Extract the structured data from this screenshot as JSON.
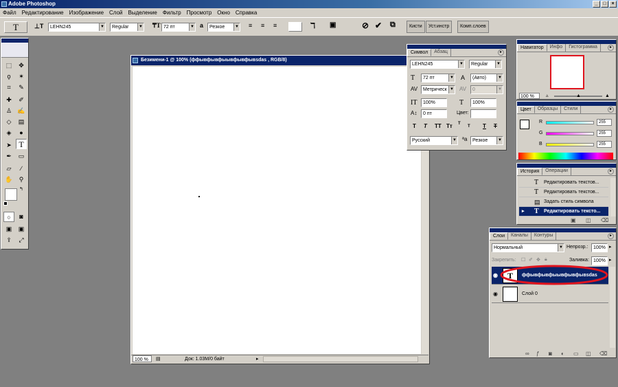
{
  "app": {
    "title": "Adobe Photoshop"
  },
  "menu": [
    "Файл",
    "Редактирование",
    "Изображение",
    "Слой",
    "Выделение",
    "Фильтр",
    "Просмотр",
    "Окно",
    "Справка"
  ],
  "options": {
    "font_family": "LEHN245",
    "font_style": "Regular",
    "font_size": "72 пт",
    "antialias": "Резкое",
    "aa_icon": "a",
    "palette_tabs": [
      "Кисти",
      "Уст.инстр",
      "Комп.слоев"
    ]
  },
  "document": {
    "title": "Безимени-1 @ 100% (ффывфывфыывфывфывsdas , RGB/8)",
    "zoom": "100 %",
    "doc_size": "Док: 1.03M/0 байт"
  },
  "character_panel": {
    "tabs": [
      "Символ",
      "Абзац"
    ],
    "font_family": "LEHN245",
    "font_style": "Regular",
    "size": "72 пт",
    "leading": "(Авто)",
    "kerning": "Метрическ",
    "tracking": "0",
    "vscale": "100%",
    "hscale": "100%",
    "baseline": "0 пт",
    "color_label": "Цвет:",
    "language": "Русский",
    "antialias": "Резкое",
    "style_buttons": [
      "T",
      "T",
      "TT",
      "Tт",
      "T",
      "T",
      "T",
      "T"
    ]
  },
  "navigator_panel": {
    "tabs": [
      "Навигатор",
      "Инфо",
      "Гистограмма"
    ],
    "zoom": "100 %"
  },
  "color_panel": {
    "tabs": [
      "Цвет",
      "Образцы",
      "Стили"
    ],
    "r_label": "R",
    "g_label": "G",
    "b_label": "B",
    "r": "255",
    "g": "255",
    "b": "255"
  },
  "history_panel": {
    "tabs": [
      "История",
      "Операции"
    ],
    "items": [
      "Редактировать текстов...",
      "Редактировать текстов...",
      "Задать стиль символа",
      "Редактировать тексто..."
    ]
  },
  "layers_panel": {
    "tabs": [
      "Слои",
      "Каналы",
      "Контуры"
    ],
    "blend_mode": "Нормальный",
    "opacity_label": "Непрозр.:",
    "opacity": "100%",
    "lock_label": "Закрепить:",
    "fill_label": "Заливка:",
    "fill": "100%",
    "layers": [
      {
        "name": "ффывфывфыывфывфывsdas",
        "thumb": "T"
      },
      {
        "name": "Слой 0",
        "thumb": ""
      }
    ]
  },
  "colors": {
    "highlight": "#0a246a",
    "annotation": "#e0141e",
    "window_bg": "#d4d0c8"
  }
}
